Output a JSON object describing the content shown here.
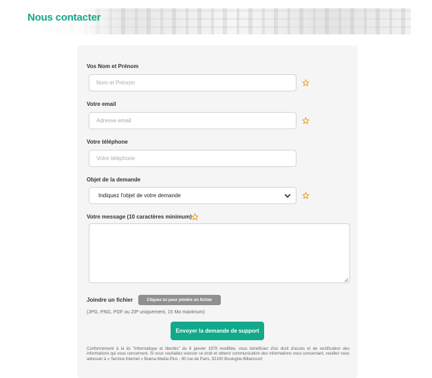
{
  "header": {
    "title": "Nous contacter"
  },
  "form": {
    "name": {
      "label": "Vos Nom et Prénom",
      "placeholder": "Nom et Prénom",
      "required_icon": "star-outline-icon"
    },
    "email": {
      "label": "Votre email",
      "placeholder": "Adresse email",
      "required_icon": "star-outline-icon"
    },
    "phone": {
      "label": "Votre téléphone",
      "placeholder": "Votre téléphone"
    },
    "subject": {
      "label": "Objet de la demande",
      "selected": "Indiquez l'objet de votre demande",
      "icon": "chevron-down-icon",
      "required_icon": "star-outline-icon"
    },
    "message": {
      "label": "Votre message (10 caractères minimum)",
      "value": "",
      "required_icon": "star-outline-icon"
    },
    "attachment": {
      "label": "Joindre un fichier",
      "button_label": "Cliquez ici pour joindre un fichier",
      "hint": "(JPG, PNG, PDF ou ZIP uniquement, 15 Mo maximum)"
    },
    "submit_label": "Envoyer la demande de support",
    "legal_text": "Conformément à la loi \"Informatique et libertés\" du 6 janvier 1978 modifiée, vous bénéficiez d'un droit d'accès et de rectification des informations qui vous concernent. Si vous souhaitez exercer ce droit et obtenir communication des informations vous concernant, veuillez vous adresser à « Service Internet » Buena Media Plus - 90 rue de Paris, 92100 Boulogne-Billancourt"
  },
  "colors": {
    "accent": "#14a88c",
    "required_star": "#f0a020",
    "panel_bg": "#f5f5f5",
    "file_button": "#8f8f8f"
  }
}
